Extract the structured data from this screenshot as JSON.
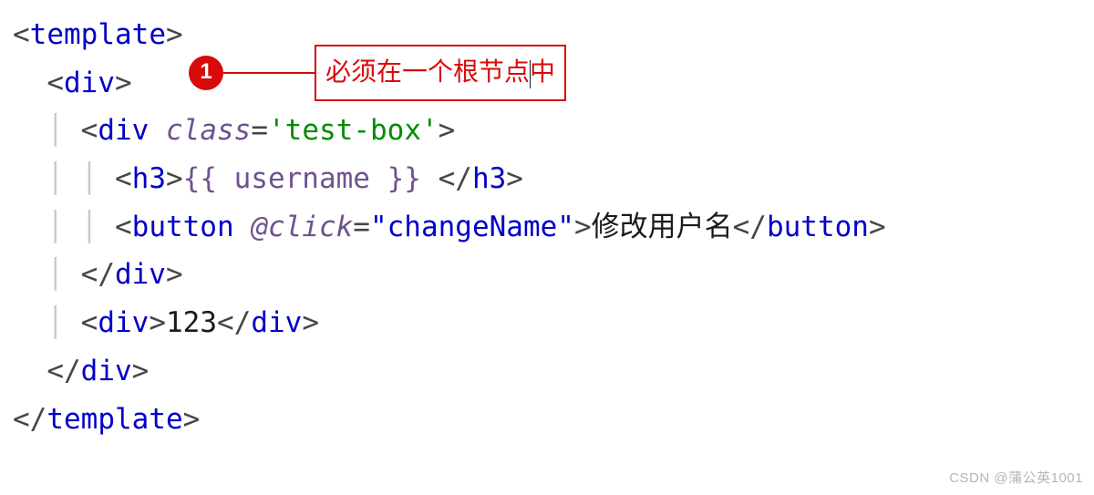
{
  "annotation": {
    "badge_number": "1",
    "callout_text_before": "必须在一个根节点",
    "callout_text_after": "中"
  },
  "code": {
    "line1": {
      "open": "<",
      "tag": "template",
      "close": ">"
    },
    "line2": {
      "open": "<",
      "tag": "div",
      "close": ">"
    },
    "line3": {
      "open": "<",
      "tag": "div",
      "attr": "class",
      "eq": "=",
      "q1": "'",
      "val": "test-box",
      "q2": "'",
      "close": ">"
    },
    "line4": {
      "open": "<",
      "tag": "h3",
      "close": ">",
      "mustache": "{{ username }}",
      "space": " ",
      "open2": "</",
      "tag2": "h3",
      "close2": ">"
    },
    "line5": {
      "open": "<",
      "tag": "button",
      "attr": "@click",
      "eq": "=",
      "q1": "\"",
      "val": "changeName",
      "q2": "\"",
      "close": ">",
      "text": "修改用户名",
      "open2": "</",
      "tag2": "button",
      "close2": ">"
    },
    "line6": {
      "open": "</",
      "tag": "div",
      "close": ">"
    },
    "line7": {
      "open": "<",
      "tag": "div",
      "close": ">",
      "text": "123",
      "open2": "</",
      "tag2": "div",
      "close2": ">"
    },
    "line8": {
      "open": "</",
      "tag": "div",
      "close": ">"
    },
    "line9": {
      "open": "</",
      "tag": "template",
      "close": ">"
    }
  },
  "watermark": "CSDN @蒲公英1001"
}
